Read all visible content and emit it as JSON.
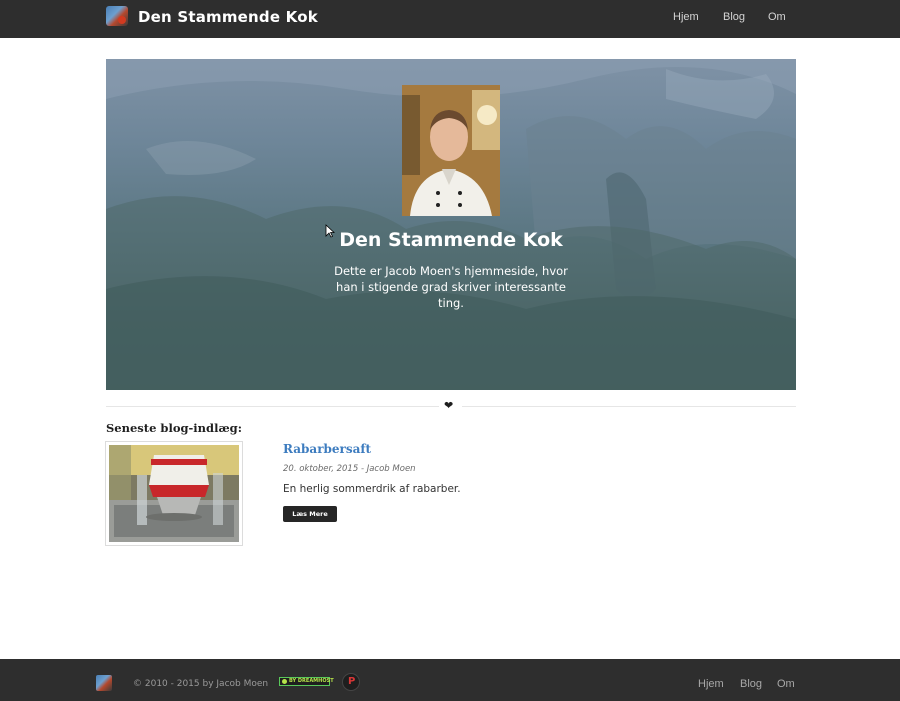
{
  "header": {
    "site_title": "Den Stammende Kok",
    "nav": [
      {
        "label": "Hjem"
      },
      {
        "label": "Blog"
      },
      {
        "label": "Om"
      }
    ]
  },
  "hero": {
    "title": "Den Stammende Kok",
    "description": "Dette er Jacob Moen's hjemmeside, hvor han i stigende grad skriver interessante ting."
  },
  "divider": {
    "icon": "heart-icon",
    "glyph": "❤"
  },
  "latest": {
    "heading": "Seneste blog-indlæg:",
    "posts": [
      {
        "title": "Rabarbersaft",
        "meta": "20. oktober, 2015 - Jacob Moen",
        "excerpt": "En herlig sommerdrik af rabarber.",
        "read_more": "Læs Mere"
      }
    ]
  },
  "footer": {
    "copyright": "© 2010 - 2015 by Jacob Moen",
    "badge_text": "BY DREAMHOST",
    "p_badge": "P",
    "nav": [
      {
        "label": "Hjem"
      },
      {
        "label": "Blog"
      },
      {
        "label": "Om"
      }
    ]
  },
  "colors": {
    "navbar": "#2e2e2e",
    "link": "#3d7cbf",
    "button": "#262626"
  }
}
